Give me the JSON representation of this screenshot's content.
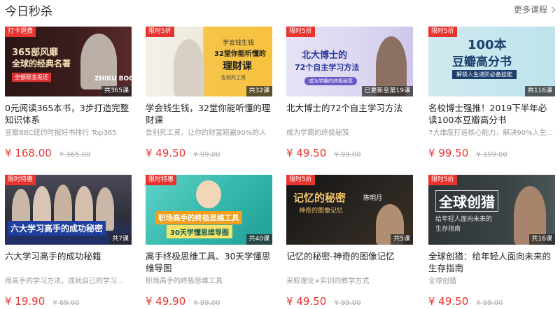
{
  "header": {
    "title": "今日秒杀",
    "more_label": "更多课程"
  },
  "cards": [
    {
      "badge": "打卡退费",
      "count": "共365课",
      "art_lines": [
        "365部风靡",
        "全球的经典名著"
      ],
      "art_tag": "全额现金返还",
      "art_brand": "ZHIKU BOOK",
      "title": "0元阅读365本书，3步打造完整知识体系",
      "subtitle": "豆瓣BBC纽约时报好书排行 Top365",
      "price": "¥ 168.00",
      "old_price": "¥ 365.00"
    },
    {
      "badge": "限时5折",
      "count": "共32课",
      "art_lines": [
        "学会钱生钱",
        "32堂你能听懂的",
        "理财课"
      ],
      "art_tag": "告别死工资",
      "title": "学会钱生钱，32堂你能听懂的理财课",
      "subtitle": "告别死工资，让你的财富跑赢90%的人",
      "price": "¥ 49.50",
      "old_price": "¥ 99.00"
    },
    {
      "badge": "限时5折",
      "count": "已更新至第19课",
      "art_lines": [
        "北大博士的",
        "72个自主学习方法"
      ],
      "art_tag": "成为学霸的终极秘笈",
      "title": "北大博士的72个自主学习方法",
      "subtitle": "成为学霸的终极秘笈",
      "price": "¥ 49.50",
      "old_price": "¥ 99.00"
    },
    {
      "badge": "限时5折",
      "count": "共116课",
      "art_lines": [
        "100本",
        "豆瓣高分书"
      ],
      "art_tag": "解锁人生进阶必备技能",
      "title": "名校博士强推！2019下半年必读100本豆瓣高分书",
      "subtitle": "7大维度打造核心能力，解决90%人生...",
      "price": "¥ 99.50",
      "old_price": "¥ 199.00"
    },
    {
      "badge": "限时特惠",
      "count": "共7课",
      "art_lines": [
        "六大学习高手的成功秘密"
      ],
      "title": "六大学习高手的成功秘籍",
      "subtitle": "用高手的学习方法，成就自己的学习...",
      "price": "¥ 19.90",
      "old_price": "¥ 69.00"
    },
    {
      "badge": "限时特惠",
      "count": "共40课",
      "art_lines": [
        "职场高手的终极思维工具",
        "30天学懂思维导图"
      ],
      "title": "高手终极思维工具、30天学懂思维导图",
      "subtitle": "职场高手的终极思维工具",
      "price": "¥ 49.90",
      "old_price": "¥ 99.00"
    },
    {
      "badge": "限时5折",
      "count": "共5课",
      "art_lines": [
        "记忆的秘密",
        "神奇的图像记忆"
      ],
      "art_tag": "陈明月",
      "title": "记忆的秘密-神奇的图像记忆",
      "subtitle": "采取理论+实训的教学方式",
      "price": "¥ 49.50",
      "old_price": "¥ 99.00"
    },
    {
      "badge": "限时5折",
      "count": "共16课",
      "art_lines": [
        "全球创猎",
        "给年轻人面向未来的",
        "生存指南"
      ],
      "title": "全球创猎：给年轻人面向未来的生存指南",
      "subtitle": "全球创猎",
      "price": "¥ 49.50",
      "old_price": "¥ 99.00"
    }
  ],
  "colors": {
    "accent": "#e8332f",
    "muted": "#999999",
    "title": "#222222"
  }
}
